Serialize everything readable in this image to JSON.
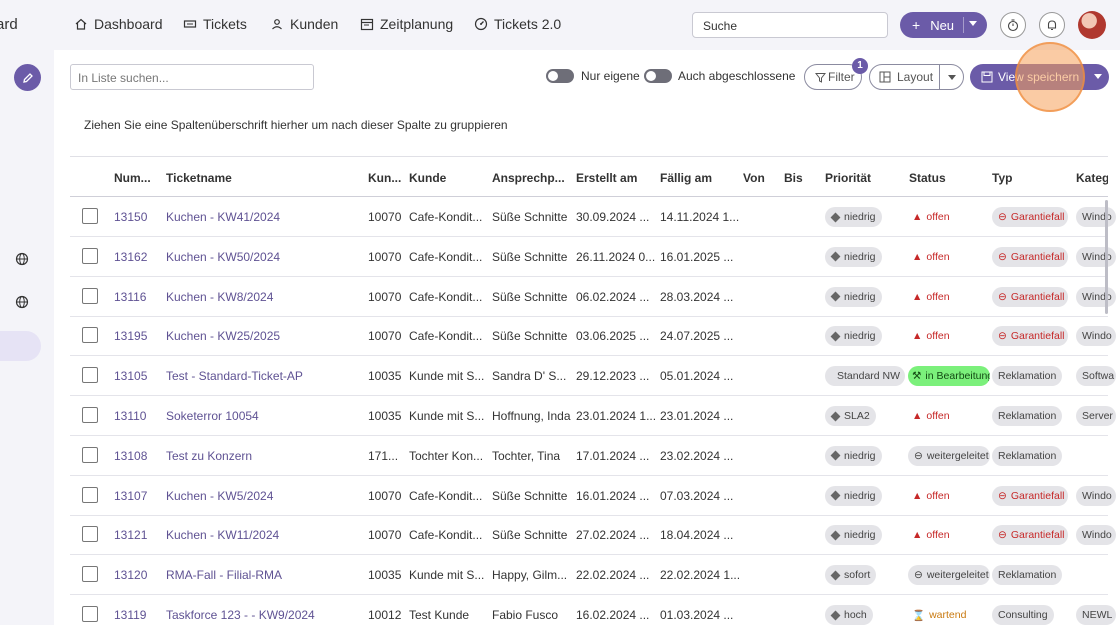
{
  "sidebar": {
    "brand_fragment": "ard"
  },
  "nav": {
    "items": [
      {
        "label": "Dashboard",
        "icon": "home-icon"
      },
      {
        "label": "Tickets",
        "icon": "ticket-icon"
      },
      {
        "label": "Kunden",
        "icon": "person-icon"
      },
      {
        "label": "Zeitplanung",
        "icon": "calendar-icon"
      },
      {
        "label": "Tickets 2.0",
        "icon": "gauge-icon"
      }
    ],
    "search_value": "Suche",
    "new_button": "Neu"
  },
  "toolbar": {
    "list_search_placeholder": "In Liste suchen...",
    "toggle_own": "Nur eigene",
    "toggle_closed": "Auch abgeschlossene",
    "filter_label": "Filter",
    "filter_count": "1",
    "layout_label": "Layout",
    "save_view_label": "View speichern"
  },
  "group_hint": "Ziehen Sie eine Spaltenüberschrift hierher um nach dieser Spalte zu gruppieren",
  "columns": [
    "Num...",
    "Ticketname",
    "Kun...",
    "Kunde",
    "Ansprechp...",
    "Erstellt am",
    "Fällig am",
    "Von",
    "Bis",
    "Priorität",
    "Status",
    "Typ",
    "Kateg"
  ],
  "rows": [
    {
      "num": "13150",
      "name": "Kuchen - KW41/2024",
      "kunnr": "10070",
      "kunde": "Cafe-Kondit...",
      "ansprech": "Süße Schnitte",
      "erstellt": "30.09.2024 ...",
      "faellig": "14.11.2024 1...",
      "prio": "niedrig",
      "status": "offen",
      "status_kind": "open",
      "typ": "Garantiefall",
      "typ_red": true,
      "kat": "Windo"
    },
    {
      "num": "13162",
      "name": "Kuchen - KW50/2024",
      "kunnr": "10070",
      "kunde": "Cafe-Kondit...",
      "ansprech": "Süße Schnitte",
      "erstellt": "26.11.2024 0...",
      "faellig": "16.01.2025 ...",
      "prio": "niedrig",
      "status": "offen",
      "status_kind": "open",
      "typ": "Garantiefall",
      "typ_red": true,
      "kat": "Windo"
    },
    {
      "num": "13116",
      "name": "Kuchen - KW8/2024",
      "kunnr": "10070",
      "kunde": "Cafe-Kondit...",
      "ansprech": "Süße Schnitte",
      "erstellt": "06.02.2024 ...",
      "faellig": "28.03.2024 ...",
      "prio": "niedrig",
      "status": "offen",
      "status_kind": "open",
      "typ": "Garantiefall",
      "typ_red": true,
      "kat": "Windo"
    },
    {
      "num": "13195",
      "name": "Kuchen - KW25/2025",
      "kunnr": "10070",
      "kunde": "Cafe-Kondit...",
      "ansprech": "Süße Schnitte",
      "erstellt": "03.06.2025 ...",
      "faellig": "24.07.2025 ...",
      "prio": "niedrig",
      "status": "offen",
      "status_kind": "open",
      "typ": "Garantiefall",
      "typ_red": true,
      "kat": "Windo"
    },
    {
      "num": "13105",
      "name": "Test - Standard-Ticket-AP",
      "kunnr": "10035",
      "kunde": "Kunde mit S...",
      "ansprech": "Sandra D' S...",
      "erstellt": "29.12.2023 ...",
      "faellig": "05.01.2024 ...",
      "prio": "Standard NW",
      "status": "in Bearbeitung",
      "status_kind": "work",
      "typ": "Reklamation",
      "typ_red": false,
      "kat": "Softwa"
    },
    {
      "num": "13110",
      "name": "Soketerror 10054",
      "kunnr": "10035",
      "kunde": "Kunde mit S...",
      "ansprech": "Hoffnung, Inda",
      "erstellt": "23.01.2024 1...",
      "faellig": "23.01.2024 ...",
      "prio": "SLA2",
      "status": "offen",
      "status_kind": "open",
      "typ": "Reklamation",
      "typ_red": false,
      "kat": "Server"
    },
    {
      "num": "13108",
      "name": "Test zu Konzern",
      "kunnr": "171...",
      "kunde": "Tochter Kon...",
      "ansprech": "Tochter, Tina",
      "erstellt": "17.01.2024 ...",
      "faellig": "23.02.2024 ...",
      "prio": "niedrig",
      "status": "weitergeleitet",
      "status_kind": "fwd",
      "typ": "Reklamation",
      "typ_red": false,
      "kat": ""
    },
    {
      "num": "13107",
      "name": "Kuchen - KW5/2024",
      "kunnr": "10070",
      "kunde": "Cafe-Kondit...",
      "ansprech": "Süße Schnitte",
      "erstellt": "16.01.2024 ...",
      "faellig": "07.03.2024 ...",
      "prio": "niedrig",
      "status": "offen",
      "status_kind": "open",
      "typ": "Garantiefall",
      "typ_red": true,
      "kat": "Windo"
    },
    {
      "num": "13121",
      "name": "Kuchen - KW11/2024",
      "kunnr": "10070",
      "kunde": "Cafe-Kondit...",
      "ansprech": "Süße Schnitte",
      "erstellt": "27.02.2024 ...",
      "faellig": "18.04.2024 ...",
      "prio": "niedrig",
      "status": "offen",
      "status_kind": "open",
      "typ": "Garantiefall",
      "typ_red": true,
      "kat": "Windo"
    },
    {
      "num": "13120",
      "name": "RMA-Fall - Filial-RMA",
      "kunnr": "10035",
      "kunde": "Kunde mit S...",
      "ansprech": "Happy, Gilm...",
      "erstellt": "22.02.2024 ...",
      "faellig": "22.02.2024 1...",
      "prio": "sofort",
      "status": "weitergeleitet",
      "status_kind": "fwd",
      "typ": "Reklamation",
      "typ_red": false,
      "kat": ""
    },
    {
      "num": "13119",
      "name": "Taskforce 123 - - KW9/2024",
      "kunnr": "10012",
      "kunde": "Test Kunde",
      "ansprech": "Fabio Fusco",
      "erstellt": "16.02.2024 ...",
      "faellig": "01.03.2024 ...",
      "prio": "hoch",
      "status": "wartend",
      "status_kind": "wait",
      "typ": "Consulting",
      "typ_red": false,
      "kat": "NEWL"
    }
  ],
  "colors": {
    "accent": "#6b5ba8",
    "status_open": "#c62828",
    "status_work": "#7bf07b",
    "highlight": "#f5a05a"
  }
}
